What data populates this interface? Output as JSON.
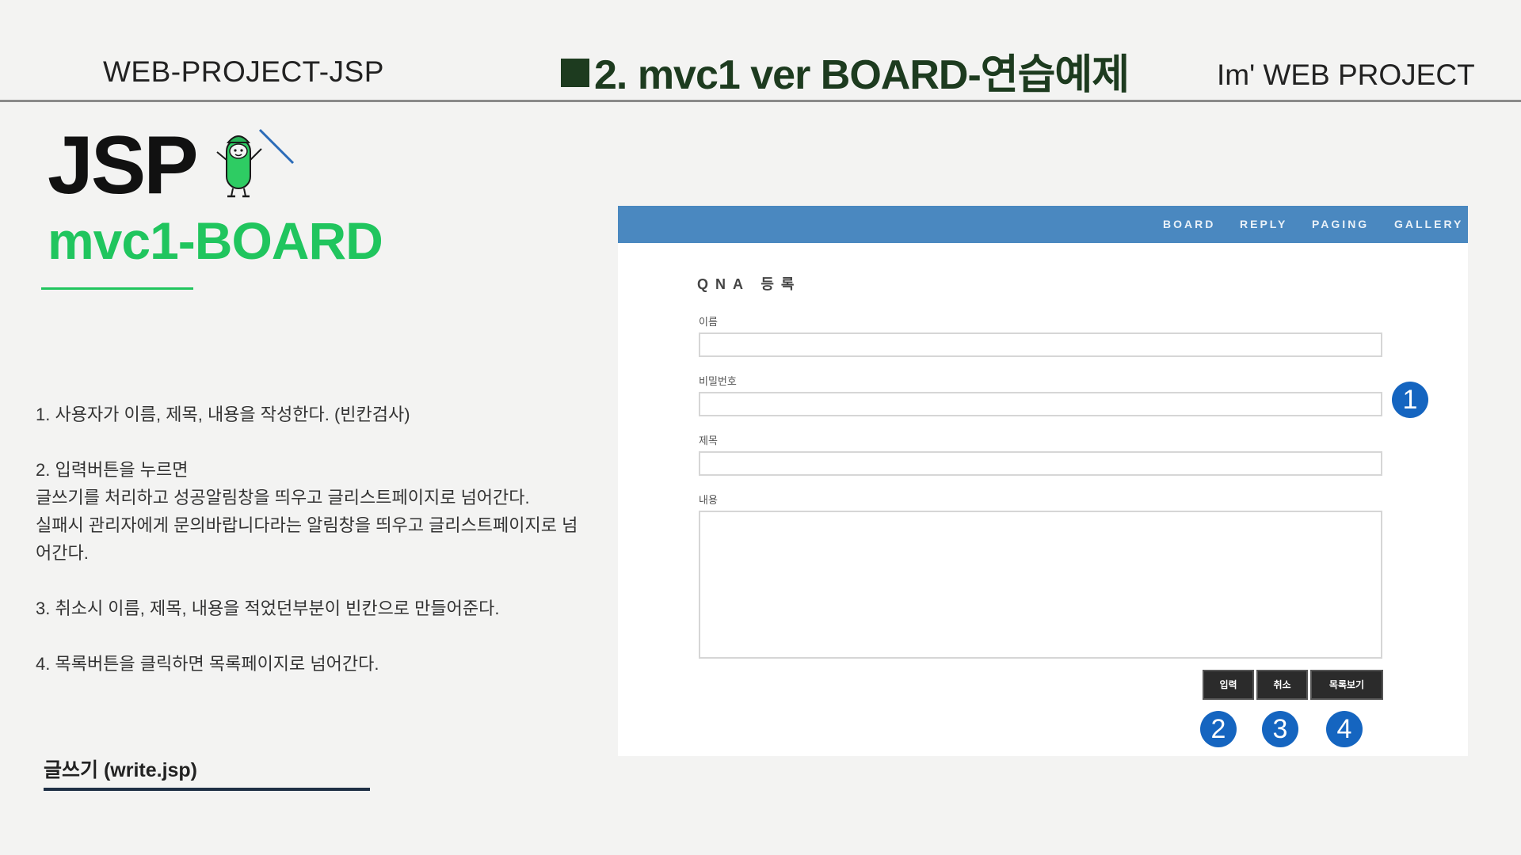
{
  "header": {
    "left": "WEB-PROJECT-JSP",
    "title": "2. mvc1 ver  BOARD-연습예제",
    "right": "Im'  WEB PROJECT"
  },
  "logo": {
    "main": "JSP",
    "sub": "mvc1-BOARD"
  },
  "description": {
    "item1": "1. 사용자가  이름, 제목, 내용을 작성한다. (빈칸검사)",
    "item2_line1": "2. 입력버튼을 누르면",
    "item2_line2": "글쓰기를 처리하고  성공알림창을 띄우고 글리스트페이지로 넘어간다.",
    "item2_line3": "실패시  관리자에게 문의바랍니다라는 알림창을 띄우고 글리스트페이지로 넘어간다.",
    "item3": "3. 취소시 이름, 제목, 내용을 적었던부분이 빈칸으로  만들어준다.",
    "item4": "4. 목록버튼을 클릭하면 목록페이지로 넘어간다."
  },
  "caption": "글쓰기  (write.jsp)",
  "screenshot": {
    "nav": [
      "BOARD",
      "REPLY",
      "PAGING",
      "GALLERY"
    ],
    "form_title": "QNA 등록",
    "labels": {
      "name": "이름",
      "password": "비밀번호",
      "subject": "제목",
      "content": "내용"
    },
    "buttons": {
      "submit": "입력",
      "cancel": "취소",
      "list": "목록보기"
    }
  },
  "badges": [
    "1",
    "2",
    "3",
    "4"
  ],
  "colors": {
    "accent_green": "#20c55e",
    "title_dark_green": "#1d3b1f",
    "nav_blue": "#4a88c0",
    "badge_blue": "#1565c0",
    "button_dark": "#2b2b2b"
  }
}
